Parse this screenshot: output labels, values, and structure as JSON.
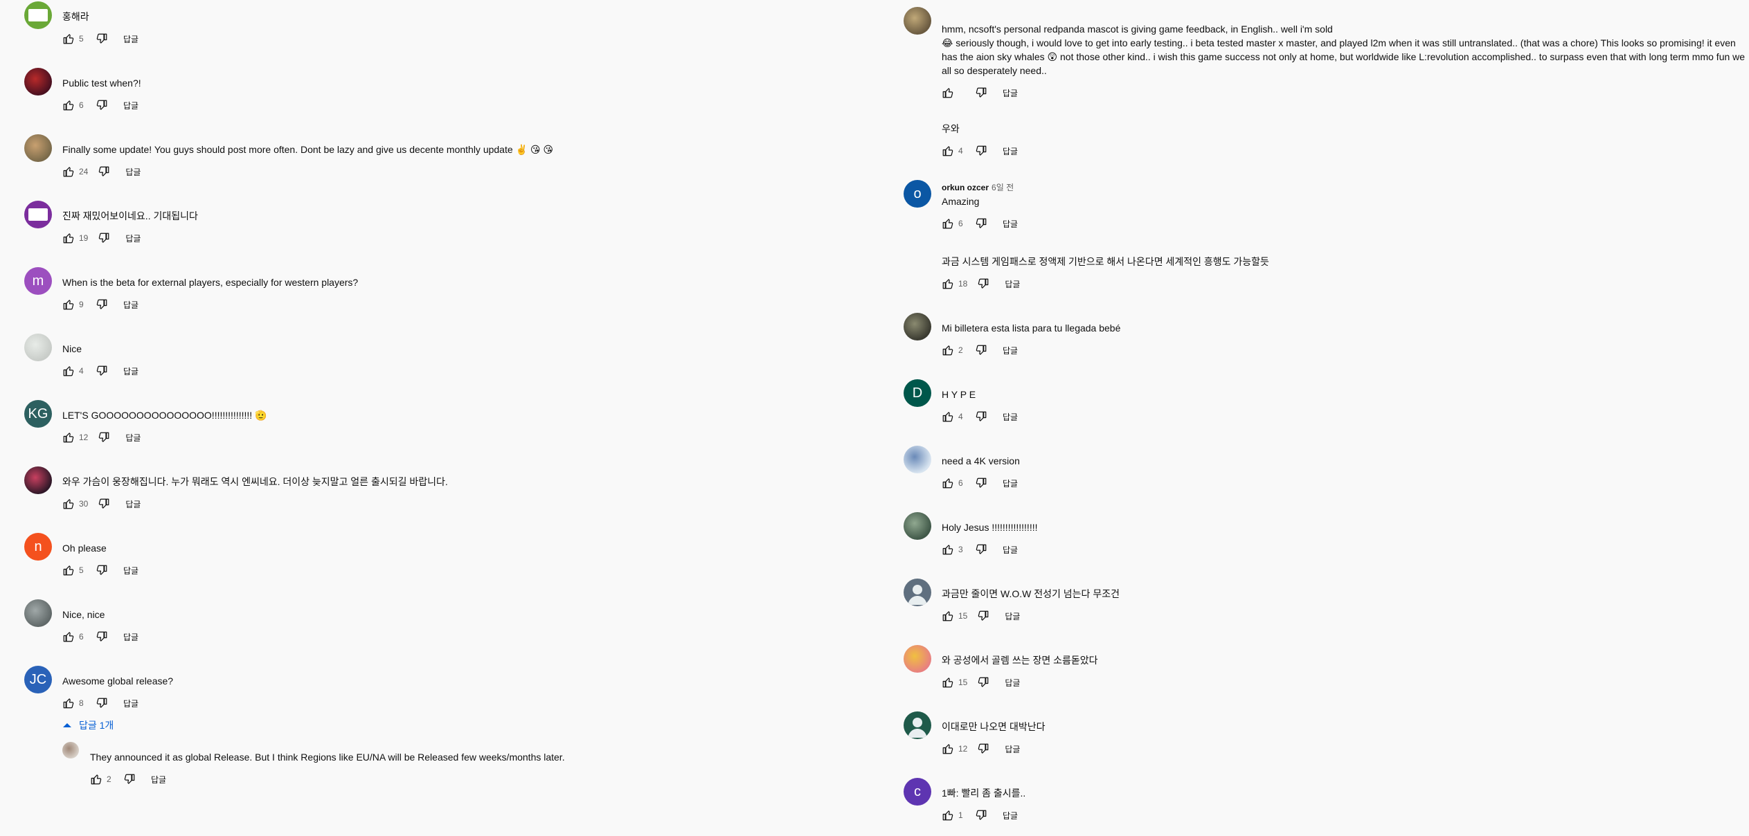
{
  "ui": {
    "reply_label": "답글"
  },
  "left_comments": [
    {
      "avatar": {
        "kind": "rect",
        "color": "#6aa837"
      },
      "text": "홍해라",
      "likes": "5"
    },
    {
      "avatar": {
        "kind": "image",
        "color": "#4a1020",
        "accent": "#b82a2a"
      },
      "text": "Public test when?!",
      "likes": "6"
    },
    {
      "avatar": {
        "kind": "image",
        "color": "#7a6a4a",
        "accent": "#c8a070"
      },
      "text": "Finally some update! You guys should post more often. Dont be lazy and give us decente monthly update ✌️ 😘 😘",
      "likes": "24"
    },
    {
      "avatar": {
        "kind": "rect",
        "color": "#7b2d9d"
      },
      "text": "진짜 재밌어보이네요.. 기대됩니다",
      "likes": "19"
    },
    {
      "avatar": {
        "kind": "letter",
        "letter": "m",
        "color": "#9c4fbf"
      },
      "text": "When is the beta for external players, especially for western players?",
      "likes": "9"
    },
    {
      "avatar": {
        "kind": "image",
        "color": "#c8ccc8",
        "accent": "#e8ece8"
      },
      "text": "Nice",
      "likes": "4"
    },
    {
      "avatar": {
        "kind": "letter",
        "letter": "KG",
        "color": "#2d6060"
      },
      "text": "LET'S GOOOOOOOOOOOOOOO!!!!!!!!!!!!!!! 🫡",
      "likes": "12"
    },
    {
      "avatar": {
        "kind": "image",
        "color": "#301828",
        "accent": "#c84060"
      },
      "text": "와우 가슴이 웅장해집니다. 누가 뭐래도 역시 엔씨네요. 더이상 늦지말고 얼른 출시되길 바랍니다.",
      "likes": "30"
    },
    {
      "avatar": {
        "kind": "letter",
        "letter": "n",
        "color": "#f4511e"
      },
      "text": "Oh please",
      "likes": "5"
    },
    {
      "avatar": {
        "kind": "image",
        "color": "#606868",
        "accent": "#a0a8a8"
      },
      "text": "Nice, nice",
      "likes": "6"
    },
    {
      "avatar": {
        "kind": "letter",
        "letter": "JC",
        "color": "#2a62b8"
      },
      "text": "Awesome global release?",
      "likes": "8"
    }
  ],
  "replies_toggle": "답글 1개",
  "reply": {
    "avatar": {
      "kind": "image",
      "color": "#d8d0c8",
      "accent": "#a08878"
    },
    "text": "They announced it as global Release. But I think Regions like EU/NA will be Released few weeks/months later.",
    "likes": "2"
  },
  "right_comments": [
    {
      "avatar": {
        "kind": "image",
        "color": "#6a5a40",
        "accent": "#c0a878"
      },
      "text": "hmm, ncsoft's personal redpanda mascot is giving game feedback, in English.. well i'm sold\n😂 seriously though, i would love to get into early testing.. i beta tested master x master, and played l2m when it was still untranslated.. (that was a chore) This looks so promising! it even has the aion sky whales 😲 not those other kind.. i wish this game success not only at home, but worldwide like L:revolution accomplished.. to surpass even that with long term mmo fun we all so desperately need..",
      "likes": ""
    },
    {
      "avatar": {
        "kind": "none"
      },
      "text": "우와",
      "likes": "4"
    },
    {
      "avatar": {
        "kind": "letter",
        "letter": "o",
        "color": "#0b57a4"
      },
      "author": "orkun ozcer",
      "time": "6일 전",
      "text": "Amazing",
      "likes": "6"
    },
    {
      "avatar": {
        "kind": "none"
      },
      "text": "과금 시스템 게임패스로 정액제 기반으로 해서 나온다면 세계적인 흥행도 가능할듯",
      "likes": "18"
    },
    {
      "avatar": {
        "kind": "image",
        "color": "#3a3a30",
        "accent": "#8a8a70"
      },
      "text": "Mi billetera esta lista para tu llegada bebé",
      "likes": "2"
    },
    {
      "avatar": {
        "kind": "letter",
        "letter": "D",
        "color": "#00574b"
      },
      "text": "H Y P E",
      "likes": "4"
    },
    {
      "avatar": {
        "kind": "image",
        "color": "#d8e4f0",
        "accent": "#6a8ab8"
      },
      "text": "need a 4K version",
      "likes": "6"
    },
    {
      "avatar": {
        "kind": "image",
        "color": "#405848",
        "accent": "#90a890"
      },
      "text": "Holy Jesus !!!!!!!!!!!!!!!!!",
      "likes": "3"
    },
    {
      "avatar": {
        "kind": "silhouette",
        "color": "#5f6f7f"
      },
      "text": "과금만 줄이면 W.O.W 전성기 넘는다 무조건",
      "likes": "15"
    },
    {
      "avatar": {
        "kind": "image",
        "color": "#e88080",
        "accent": "#f0c040"
      },
      "text": "와 공성에서 골렘 쓰는 장면 소름돋았다",
      "likes": "15"
    },
    {
      "avatar": {
        "kind": "silhouette",
        "color": "#1f5a4a"
      },
      "text": "이대로만 나오면 대박난다",
      "likes": "12"
    },
    {
      "avatar": {
        "kind": "letter",
        "letter": "c",
        "color": "#5e35b1"
      },
      "text": "1빠: 빨리 좀 출시를..",
      "likes": "1"
    }
  ]
}
